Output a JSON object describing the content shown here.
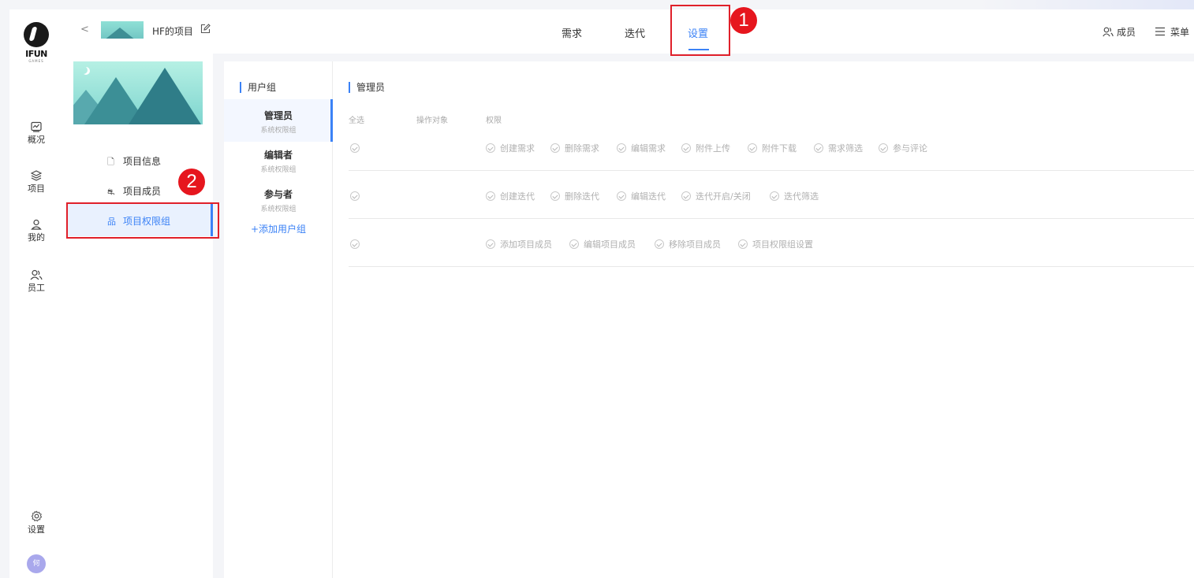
{
  "rail": {
    "logo_text": "IFUN",
    "logo_sub": "GAMES",
    "items": [
      {
        "label": "概况",
        "icon": "chart-icon"
      },
      {
        "label": "项目",
        "icon": "layers-icon"
      },
      {
        "label": "我的",
        "icon": "user-icon"
      },
      {
        "label": "员工",
        "icon": "users-icon"
      }
    ],
    "settings_label": "设置",
    "avatar_text": "何"
  },
  "topbar": {
    "back": "<",
    "project_name": "HF的项目",
    "tabs": [
      "需求",
      "迭代",
      "设置"
    ],
    "active_tab": "设置",
    "members_label": "成员",
    "menu_label": "菜单"
  },
  "annotations": {
    "one": "1",
    "two": "2"
  },
  "settings_menu": {
    "items": [
      {
        "label": "项目信息",
        "icon": "document-icon"
      },
      {
        "label": "项目成员",
        "icon": "members-icon"
      },
      {
        "label": "项目权限组",
        "icon": "org-icon"
      }
    ],
    "active": "项目权限组"
  },
  "groups": {
    "title": "用户组",
    "items": [
      {
        "name": "管理员",
        "sub": "系统权限组"
      },
      {
        "name": "编辑者",
        "sub": "系统权限组"
      },
      {
        "name": "参与者",
        "sub": "系统权限组"
      }
    ],
    "add_label": "+添加用户组"
  },
  "permissions": {
    "title": "管理员",
    "headers": {
      "select_all": "全选",
      "target": "操作对象",
      "perms": "权限"
    },
    "rows": [
      [
        "创建需求",
        "删除需求",
        "编辑需求",
        "附件上传",
        "附件下载",
        "需求筛选",
        "参与评论"
      ],
      [
        "创建迭代",
        "删除迭代",
        "编辑迭代",
        "迭代开启/关闭",
        "迭代筛选"
      ],
      [
        "添加项目成员",
        "编辑项目成员",
        "移除项目成员",
        "项目权限组设置"
      ]
    ]
  },
  "colors": {
    "accent": "#3b82f6",
    "annotation": "#e6161e"
  }
}
